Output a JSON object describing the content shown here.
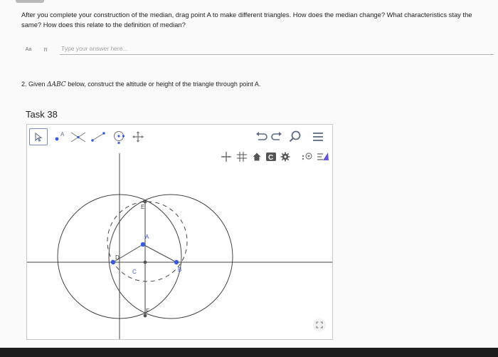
{
  "question1": {
    "text": "After you complete your construction of the median, drag point A to make different triangles. How does the median change? What characteristics stay the same? How does this relate to the definition of median?"
  },
  "answer": {
    "format_button": "Aa",
    "math_button": "π",
    "placeholder": "Type your answer here..."
  },
  "question2": {
    "prefix": "2. Given ",
    "math": "ΔABC",
    "suffix": " below, construct the altitude or height of the triangle through point A."
  },
  "task": {
    "title": "Task 38"
  },
  "geometry": {
    "points": {
      "A": "A",
      "B": "B",
      "C": "C",
      "D": "D",
      "E": "E",
      "F": "F"
    },
    "colors": {
      "point_blue": "#3b5bd9",
      "line": "#444444",
      "toolbar_icon": "#5e6b86",
      "accent_purple": "#6557d2"
    },
    "toolbar_icons": [
      "move-tool-icon",
      "point-tool-icon",
      "perpendicular-line-tool-icon",
      "segment-tool-icon",
      "circle-tool-icon",
      "move-view-tool-icon",
      "undo-icon",
      "redo-icon",
      "search-icon",
      "menu-icon"
    ],
    "stylebar_icons": [
      "axes-icon",
      "grid-icon",
      "home-icon",
      "capture-icon",
      "settings-icon",
      "point-capture-icon",
      "style-panel-icon"
    ]
  }
}
